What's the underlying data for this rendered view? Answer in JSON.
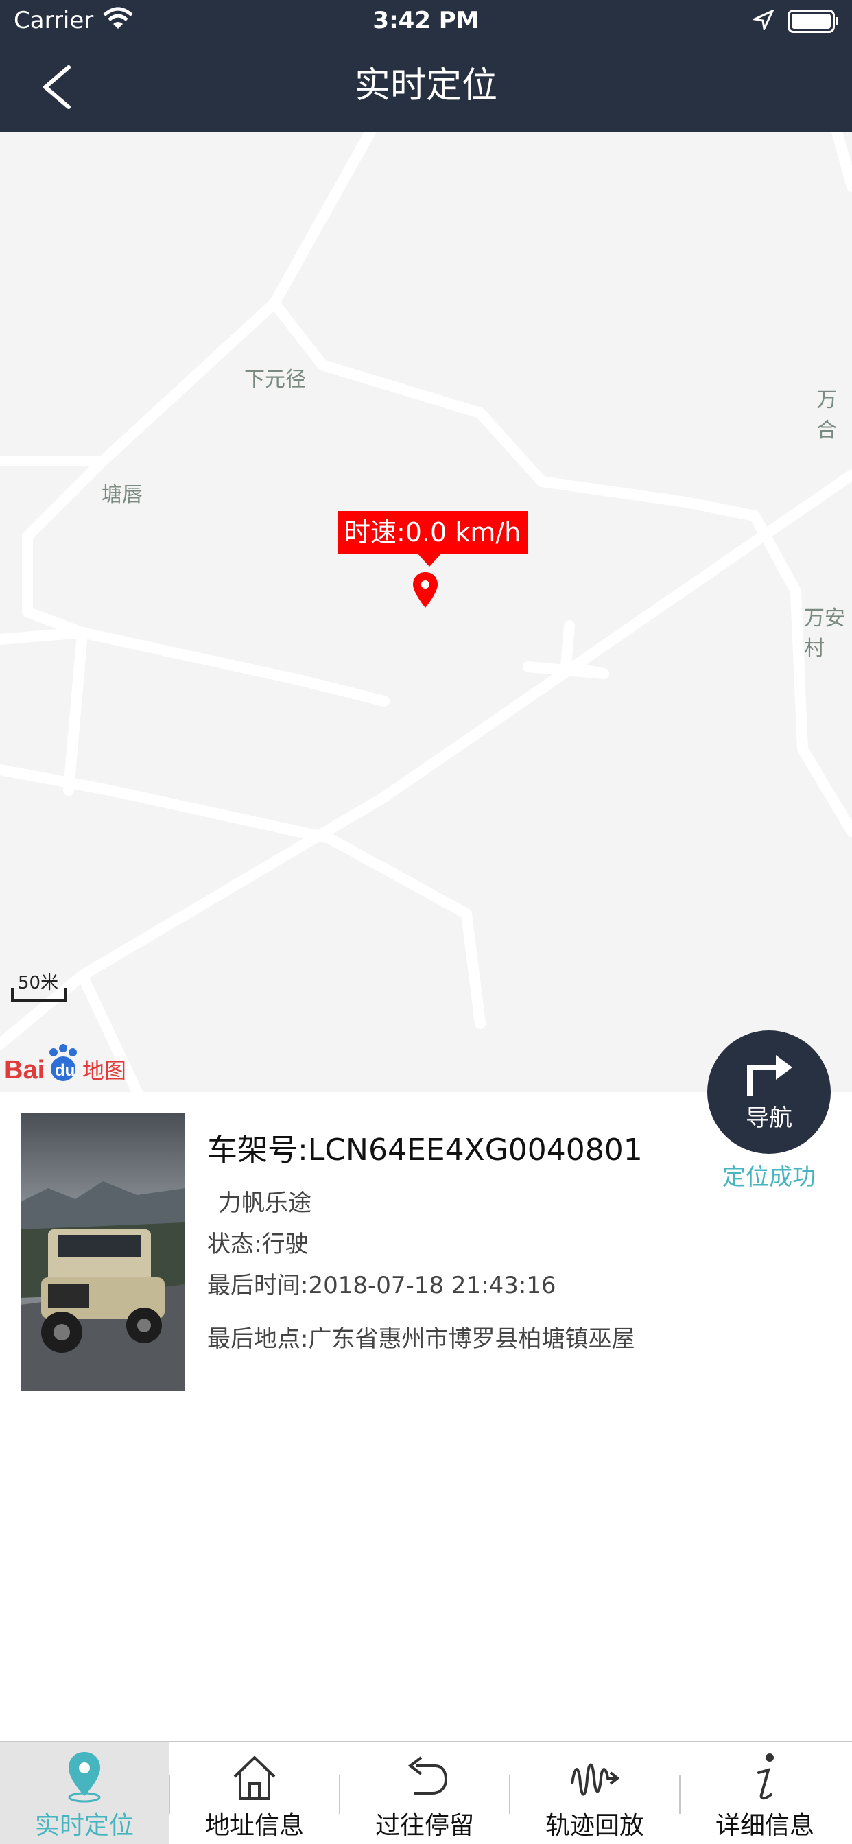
{
  "status_bar": {
    "carrier": "Carrier",
    "time": "3:42 PM"
  },
  "header": {
    "title": "实时定位"
  },
  "map": {
    "places": [
      "下元径",
      "塘唇",
      "万合",
      "万安村"
    ],
    "speed_label": "时速:0.0 km/h",
    "scale": "50米",
    "logo": "Baidu地图"
  },
  "navigation": {
    "button_label": "导航",
    "status": "定位成功"
  },
  "vehicle": {
    "frame_number": "车架号:LCN64EE4XG0040801",
    "model": "力帆乐途",
    "state": "状态:行驶",
    "last_time": "最后时间:2018-07-18 21:43:16",
    "last_place": "最后地点:广东省惠州市博罗县柏塘镇巫屋"
  },
  "tabs": [
    {
      "label": "实时定位",
      "icon": "location-pin-icon",
      "active": true
    },
    {
      "label": "地址信息",
      "icon": "home-icon",
      "active": false
    },
    {
      "label": "过往停留",
      "icon": "undo-arrow-icon",
      "active": false
    },
    {
      "label": "轨迹回放",
      "icon": "track-replay-icon",
      "active": false
    },
    {
      "label": "详细信息",
      "icon": "info-icon",
      "active": false
    }
  ],
  "colors": {
    "header": "#283142",
    "accent": "#46b5c0",
    "speed_label": "#ff0000"
  }
}
